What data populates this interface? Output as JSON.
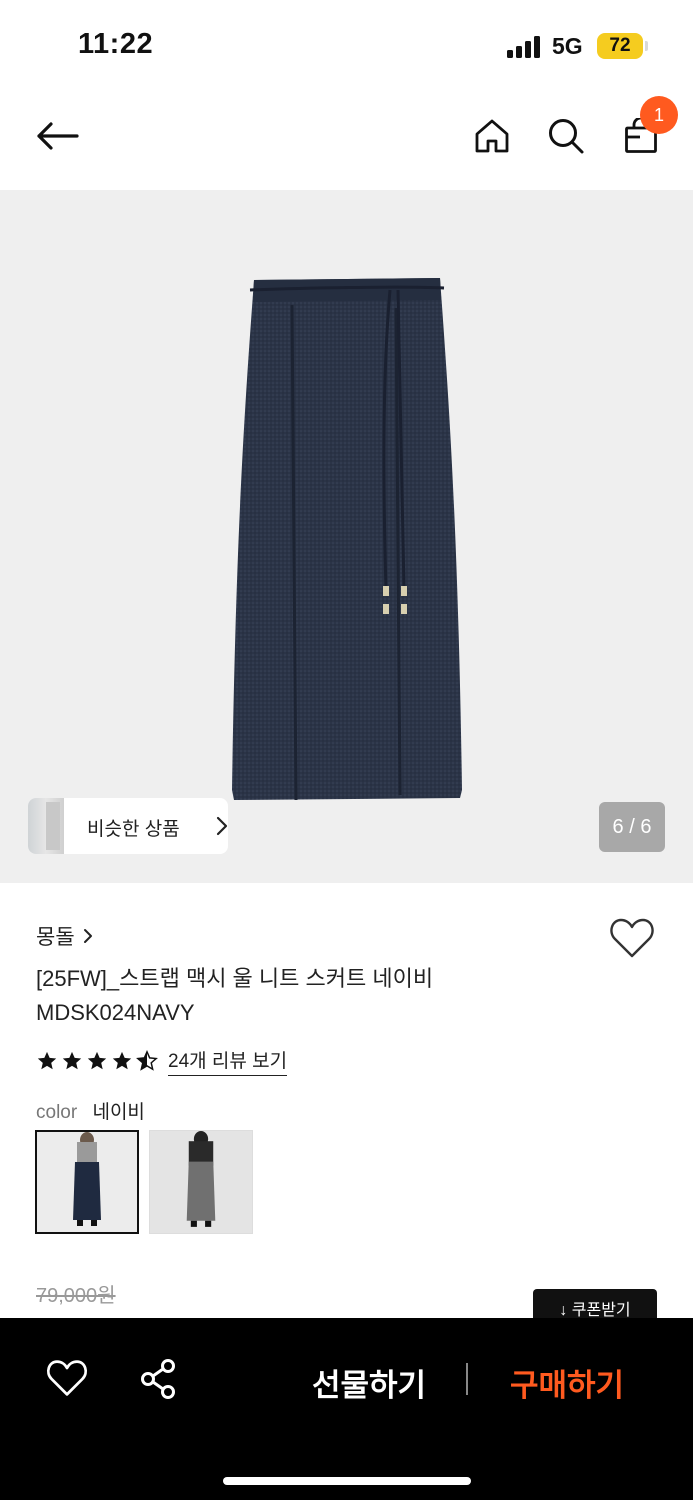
{
  "status_bar": {
    "time": "11:22",
    "network": "5G",
    "battery": "72"
  },
  "header": {
    "cart_count": "1"
  },
  "gallery": {
    "similar_label": "비슷한 상품",
    "page_counter": "6 / 6"
  },
  "product": {
    "brand": "몽돌",
    "name_line1": "[25FW]_스트랩 맥시 울 니트 스커트 네이비",
    "name_line2": "MDSK024NAVY",
    "rating": 4.5,
    "review_link": "24개 리뷰 보기",
    "color_key": "color",
    "color_value": "네이비",
    "original_price": "79,000원",
    "coupon_label": "↓ 쿠폰받기"
  },
  "bottom_bar": {
    "gift_label": "선물하기",
    "buy_label": "구매하기"
  },
  "colors": {
    "accent": "#ff5a1f",
    "battery": "#f5cc1f",
    "skirt_navy": "#2b3447"
  }
}
